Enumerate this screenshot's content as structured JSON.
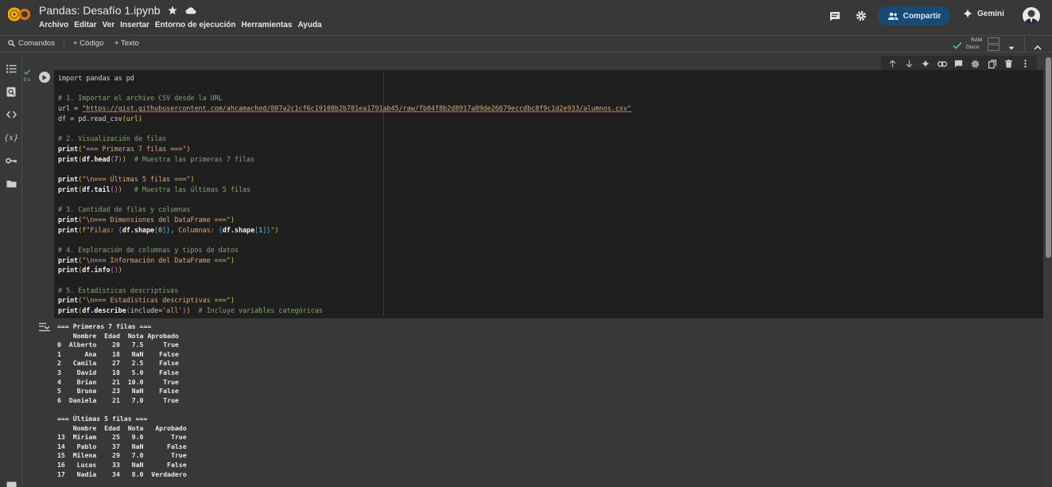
{
  "header": {
    "doc_title": "Pandas: Desafío 1.ipynb",
    "menu": [
      "Archivo",
      "Editar",
      "Ver",
      "Insertar",
      "Entorno de ejecución",
      "Herramientas",
      "Ayuda"
    ],
    "share_label": "Compartir",
    "gemini_label": "Gemini"
  },
  "toolbar": {
    "commands_label": "Comandos",
    "add_code_label": "+ Código",
    "add_text_label": "+ Texto",
    "ram_label": "RAM",
    "disk_label": "Disco"
  },
  "cell": {
    "status_count": "0 s",
    "code": {
      "l1": "import pandas as pd",
      "c1": "# 1. Importar el archivo CSV desde la URL",
      "url_var": "url = ",
      "url_value": "\"https://gist.githubusercontent.com/ahcamachod/807a2c1cf6c19108b2b701ea1791ab45/raw/fb84f8b2d8917a89de26679eccdbc8f9c1d2e933/alumnos.csv\"",
      "read_a": "df = pd.read_csv",
      "read_b": "(url)",
      "c2": "# 2. Visualización de filas",
      "p1_a": "print",
      "p1_s": "\"=== Primeras 7 filas ===\"",
      "p2_a": "print",
      "p2_b": "df.head",
      "p2_n": "7",
      "p2_c": "# Muestra las primeras 7 filas",
      "p3_s": "\"\\n=== Últimas 5 filas ===\"",
      "p4_b": "df.tail",
      "p4_c": "# Muestra las últimas 5 filas",
      "c3": "# 3. Cantidad de filas y columnas",
      "p5_s": "\"\\n=== Dimensiones del DataFrame ===\"",
      "p6_a": "f\"Filas: ",
      "p6_b": "df.shape",
      "p6_n0": "0",
      "p6_m": ", Columnas: ",
      "p6_n1": "1",
      "c4": "# 4. Exploración de columnas y tipos de datos",
      "p7_s": "\"\\n=== Información del DataFrame ===\"",
      "p8_b": "df.info",
      "c5": "# 5. Estadísticas descriptivas",
      "p9_s": "\"\\n=== Estadísticas descriptivas ===\"",
      "p10_b": "df.describe",
      "p10_arg": "include=",
      "p10_s": "'all'",
      "p10_c": "# Incluye variables categóricas"
    }
  },
  "output": {
    "head_title": "=== Primeras 7 filas ===",
    "head_header": "    Nombre  Edad  Nota Aprobado",
    "head_rows": [
      "0  Alberto    20   7.5     True",
      "1      Ana    18   NaN    False",
      "2   Camila    27   2.5    False",
      "3    David    18   5.0    False",
      "4    Brian    21  10.0     True",
      "5    Bruna    23   NaN    False",
      "6  Daniela    21   7.0     True"
    ],
    "tail_title": "=== Últimas 5 filas ===",
    "tail_header": "    Nombre  Edad  Nota   Aprobado",
    "tail_rows": [
      "13  Miriam    25   9.0       True",
      "14   Pablo    37   NaN      False",
      "15  Milena    29   7.0       True",
      "16   Lucas    33   NaN      False",
      "17   Nadia    34   8.0  Verdadero"
    ]
  },
  "colors": {
    "accent": "#1a4a73",
    "logo_orange": "#f9ab00",
    "logo_dark_orange": "#e8710a"
  }
}
